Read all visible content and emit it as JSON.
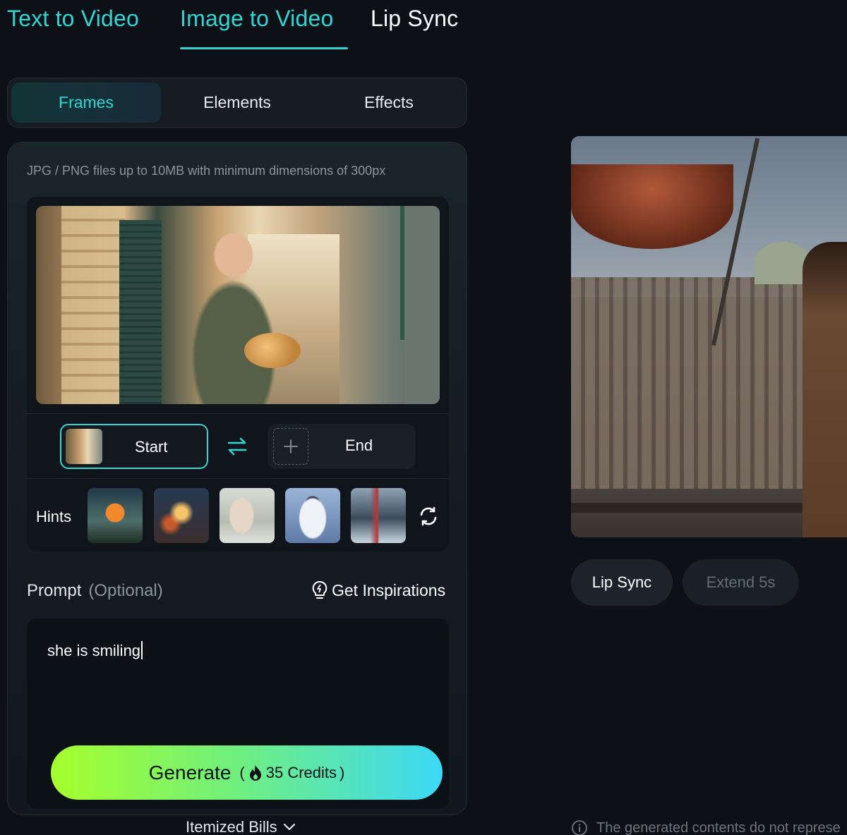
{
  "top_tabs": [
    {
      "label": "Text to Video",
      "active": false
    },
    {
      "label": "Image to Video",
      "active": true
    },
    {
      "label": "Lip Sync",
      "active": false
    }
  ],
  "segments": [
    {
      "label": "Frames",
      "active": true
    },
    {
      "label": "Elements",
      "active": false
    },
    {
      "label": "Effects",
      "active": false
    }
  ],
  "upload": {
    "hint": "JPG / PNG files up to 10MB with minimum dimensions of 300px"
  },
  "frames": {
    "start_label": "Start",
    "end_label": "End"
  },
  "hints": {
    "label": "Hints"
  },
  "prompt": {
    "label": "Prompt",
    "optional": "(Optional)",
    "inspirations": "Get Inspirations",
    "value": "she is smiling"
  },
  "generate": {
    "label": "Generate",
    "credits": "35 Credits"
  },
  "itemized_bills": "Itemized Bills",
  "preview_actions": {
    "lip_sync": "Lip Sync",
    "extend": "Extend 5s"
  },
  "disclaimer": "The generated contents do not represe",
  "colors": {
    "accent": "#2fd6d2",
    "background": "#0d1117",
    "generate_gradient_start": "#a6ff2b",
    "generate_gradient_end": "#3cd8f6"
  }
}
